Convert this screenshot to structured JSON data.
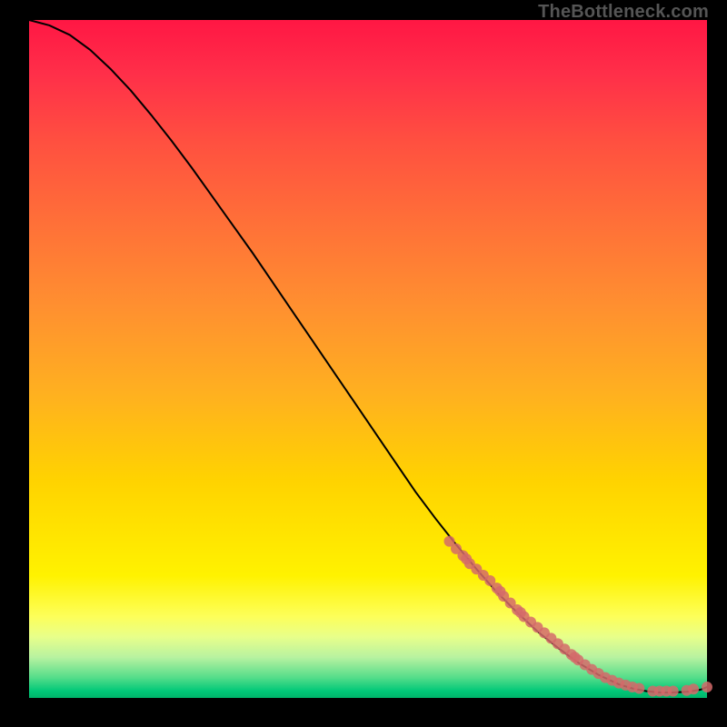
{
  "watermark": "TheBottleneck.com",
  "chart_data": {
    "type": "line",
    "title": "",
    "xlabel": "",
    "ylabel": "",
    "xlim": [
      0,
      100
    ],
    "ylim": [
      0,
      100
    ],
    "grid": false,
    "legend": false,
    "series": [
      {
        "name": "curve",
        "color": "#000000",
        "x": [
          0,
          3,
          6,
          9,
          12,
          15,
          18,
          21,
          24,
          27,
          30,
          33,
          36,
          39,
          42,
          45,
          48,
          51,
          54,
          57,
          60,
          63,
          66,
          69,
          72,
          75,
          78,
          81,
          84,
          87,
          89,
          91,
          93,
          95,
          97,
          99,
          100
        ],
        "y": [
          100,
          99.2,
          97.8,
          95.6,
          92.8,
          89.6,
          86.0,
          82.2,
          78.2,
          74.0,
          69.8,
          65.6,
          61.2,
          56.8,
          52.4,
          48.0,
          43.6,
          39.2,
          34.8,
          30.4,
          26.4,
          22.6,
          19.0,
          15.6,
          12.6,
          9.8,
          7.4,
          5.2,
          3.4,
          2.0,
          1.4,
          1.0,
          0.8,
          0.8,
          0.9,
          1.2,
          1.6
        ]
      },
      {
        "name": "points",
        "color": "#d46a6a",
        "type": "scatter",
        "x": [
          62,
          63,
          64,
          64.5,
          65,
          66,
          67,
          68,
          69,
          69.5,
          70,
          71,
          72,
          72.5,
          73,
          74,
          75,
          76,
          77,
          78,
          79,
          80,
          80.5,
          81,
          82,
          83,
          84,
          85,
          86,
          87,
          88,
          89,
          90,
          92,
          93,
          94,
          95,
          97,
          98,
          100
        ],
        "y": [
          23.1,
          22.0,
          21.0,
          20.5,
          19.8,
          19.0,
          18.1,
          17.3,
          16.2,
          15.7,
          15.0,
          14.0,
          13.0,
          12.6,
          12.0,
          11.2,
          10.4,
          9.6,
          8.8,
          8.0,
          7.2,
          6.4,
          6.0,
          5.6,
          4.9,
          4.2,
          3.6,
          3.0,
          2.6,
          2.2,
          1.9,
          1.6,
          1.4,
          1.0,
          1.0,
          1.0,
          1.0,
          1.1,
          1.3,
          1.6
        ]
      }
    ]
  }
}
